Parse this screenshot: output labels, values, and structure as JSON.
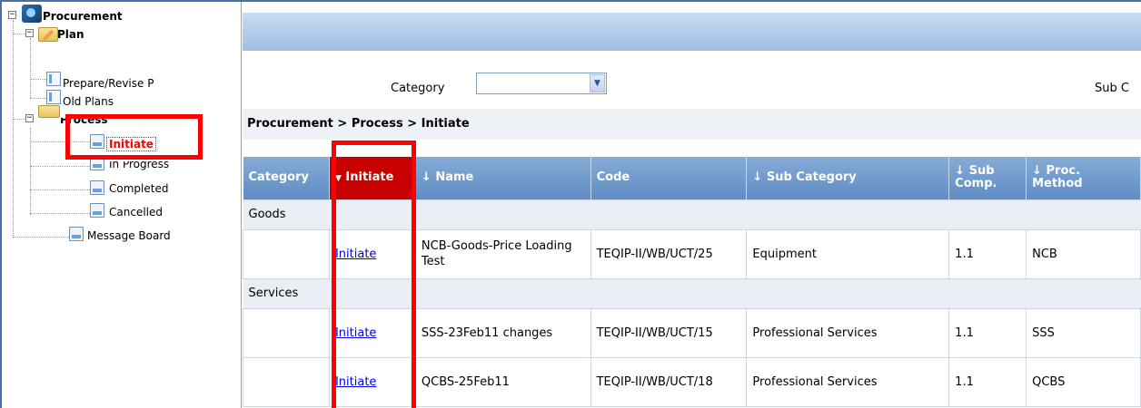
{
  "tree": {
    "root": "Procurement",
    "plan": {
      "label": "Plan",
      "items": [
        "Prepare/Revise P",
        "Old Plans"
      ]
    },
    "process": {
      "label": "Process",
      "items": [
        "Initiate",
        "In Progress",
        "Completed",
        "Cancelled"
      ]
    },
    "message_board": "Message Board",
    "expand_symbol": "⊟"
  },
  "filter": {
    "category_label": "Category",
    "category_value": "",
    "sub_label": "Sub C"
  },
  "breadcrumb": "Procurement > Process > Initiate",
  "table": {
    "headers": [
      "Category",
      "Initiate",
      "Name",
      "Code",
      "Sub Category",
      "Sub Comp.",
      "Proc. Method"
    ],
    "sort_arrow": "↓",
    "sort_active": "▼",
    "groups": [
      {
        "name": "Goods",
        "rows": [
          {
            "action": "Initiate",
            "name": "NCB-Goods-Price Loading Test",
            "code": "TEQIP-II/WB/UCT/25",
            "subcat": "Equipment",
            "subcomp": "1.1",
            "method": "NCB"
          }
        ]
      },
      {
        "name": "Services",
        "rows": [
          {
            "action": "Initiate",
            "name": "SSS-23Feb11 changes",
            "code": "TEQIP-II/WB/UCT/15",
            "subcat": "Professional Services",
            "subcomp": "1.1",
            "method": "SSS"
          },
          {
            "action": "Initiate",
            "name": "QCBS-25Feb11",
            "code": "TEQIP-II/WB/UCT/18",
            "subcat": "Professional Services",
            "subcomp": "1.1",
            "method": "QCBS"
          }
        ]
      }
    ]
  },
  "colors": {
    "header": "#6f98cb",
    "sorted_header": "#c70000",
    "annotation": "#ff0000",
    "link": "#0000ee"
  }
}
